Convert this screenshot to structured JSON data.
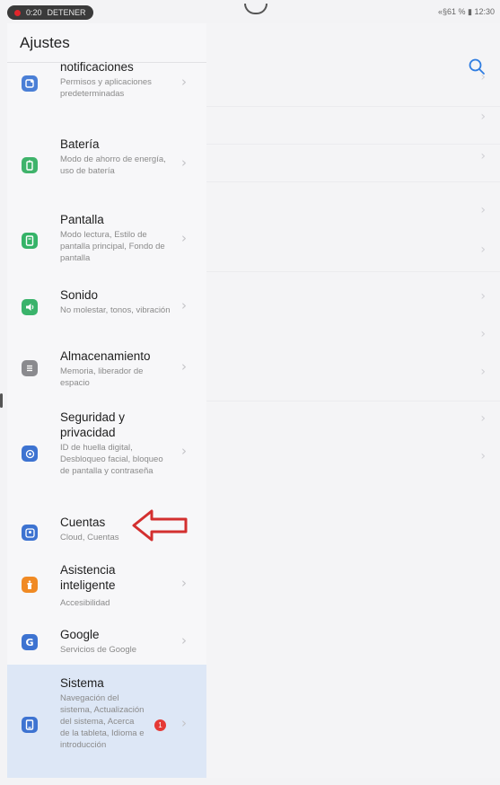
{
  "status": {
    "recording_time": "0:20",
    "recording_stop": "DETENER",
    "system": "«§61 % ▮ 12:30"
  },
  "left": {
    "title": "Ajustes",
    "items": [
      {
        "title": "notificaciones",
        "subtitle": "Permisos y aplicaciones predeterminadas",
        "icon": "notifications-icon",
        "color": "#4a7fd6"
      },
      {
        "title": "Batería",
        "subtitle": "Modo de ahorro de energía, uso de batería",
        "icon": "battery-icon",
        "color": "#3fb36b"
      },
      {
        "title": "Pantalla",
        "subtitle": "Modo lectura, Estilo de pantalla principal, Fondo de pantalla",
        "icon": "display-icon",
        "color": "#35b368"
      },
      {
        "title": "Sonido",
        "subtitle": "No molestar, tonos, vibración",
        "icon": "sound-icon",
        "color": "#3ab36b"
      },
      {
        "title": "Almacenamiento",
        "subtitle": "Memoria, liberador de espacio",
        "icon": "storage-icon",
        "color": "#8a8a8e"
      },
      {
        "title": "Seguridad y privacidad",
        "subtitle": "ID de huella digital, Desbloqueo facial, bloqueo de pantalla y contraseña",
        "icon": "security-icon",
        "color": "#3d73d1"
      },
      {
        "title": "Cuentas",
        "subtitle": "Cloud, Cuentas",
        "icon": "accounts-icon",
        "color": "#3d73d1"
      },
      {
        "title": "Asistencia inteligente",
        "subtitle": "Accesibilidad",
        "icon": "assistant-icon",
        "color": "#f08a24"
      },
      {
        "title": "Google",
        "subtitle": "Servicios de Google",
        "icon": "google-icon",
        "color": "#3d73d1"
      },
      {
        "title": "Sistema",
        "subtitle": "Navegación del sistema, Actualización del sistema, Acerca de la tableta, Idioma e introducción",
        "icon": "system-icon",
        "color": "#3d73d1",
        "selected": true,
        "badge": "1"
      }
    ]
  },
  "colors": {
    "annotation_arrow": "#d32f2f",
    "accent": "#2f7de1"
  }
}
